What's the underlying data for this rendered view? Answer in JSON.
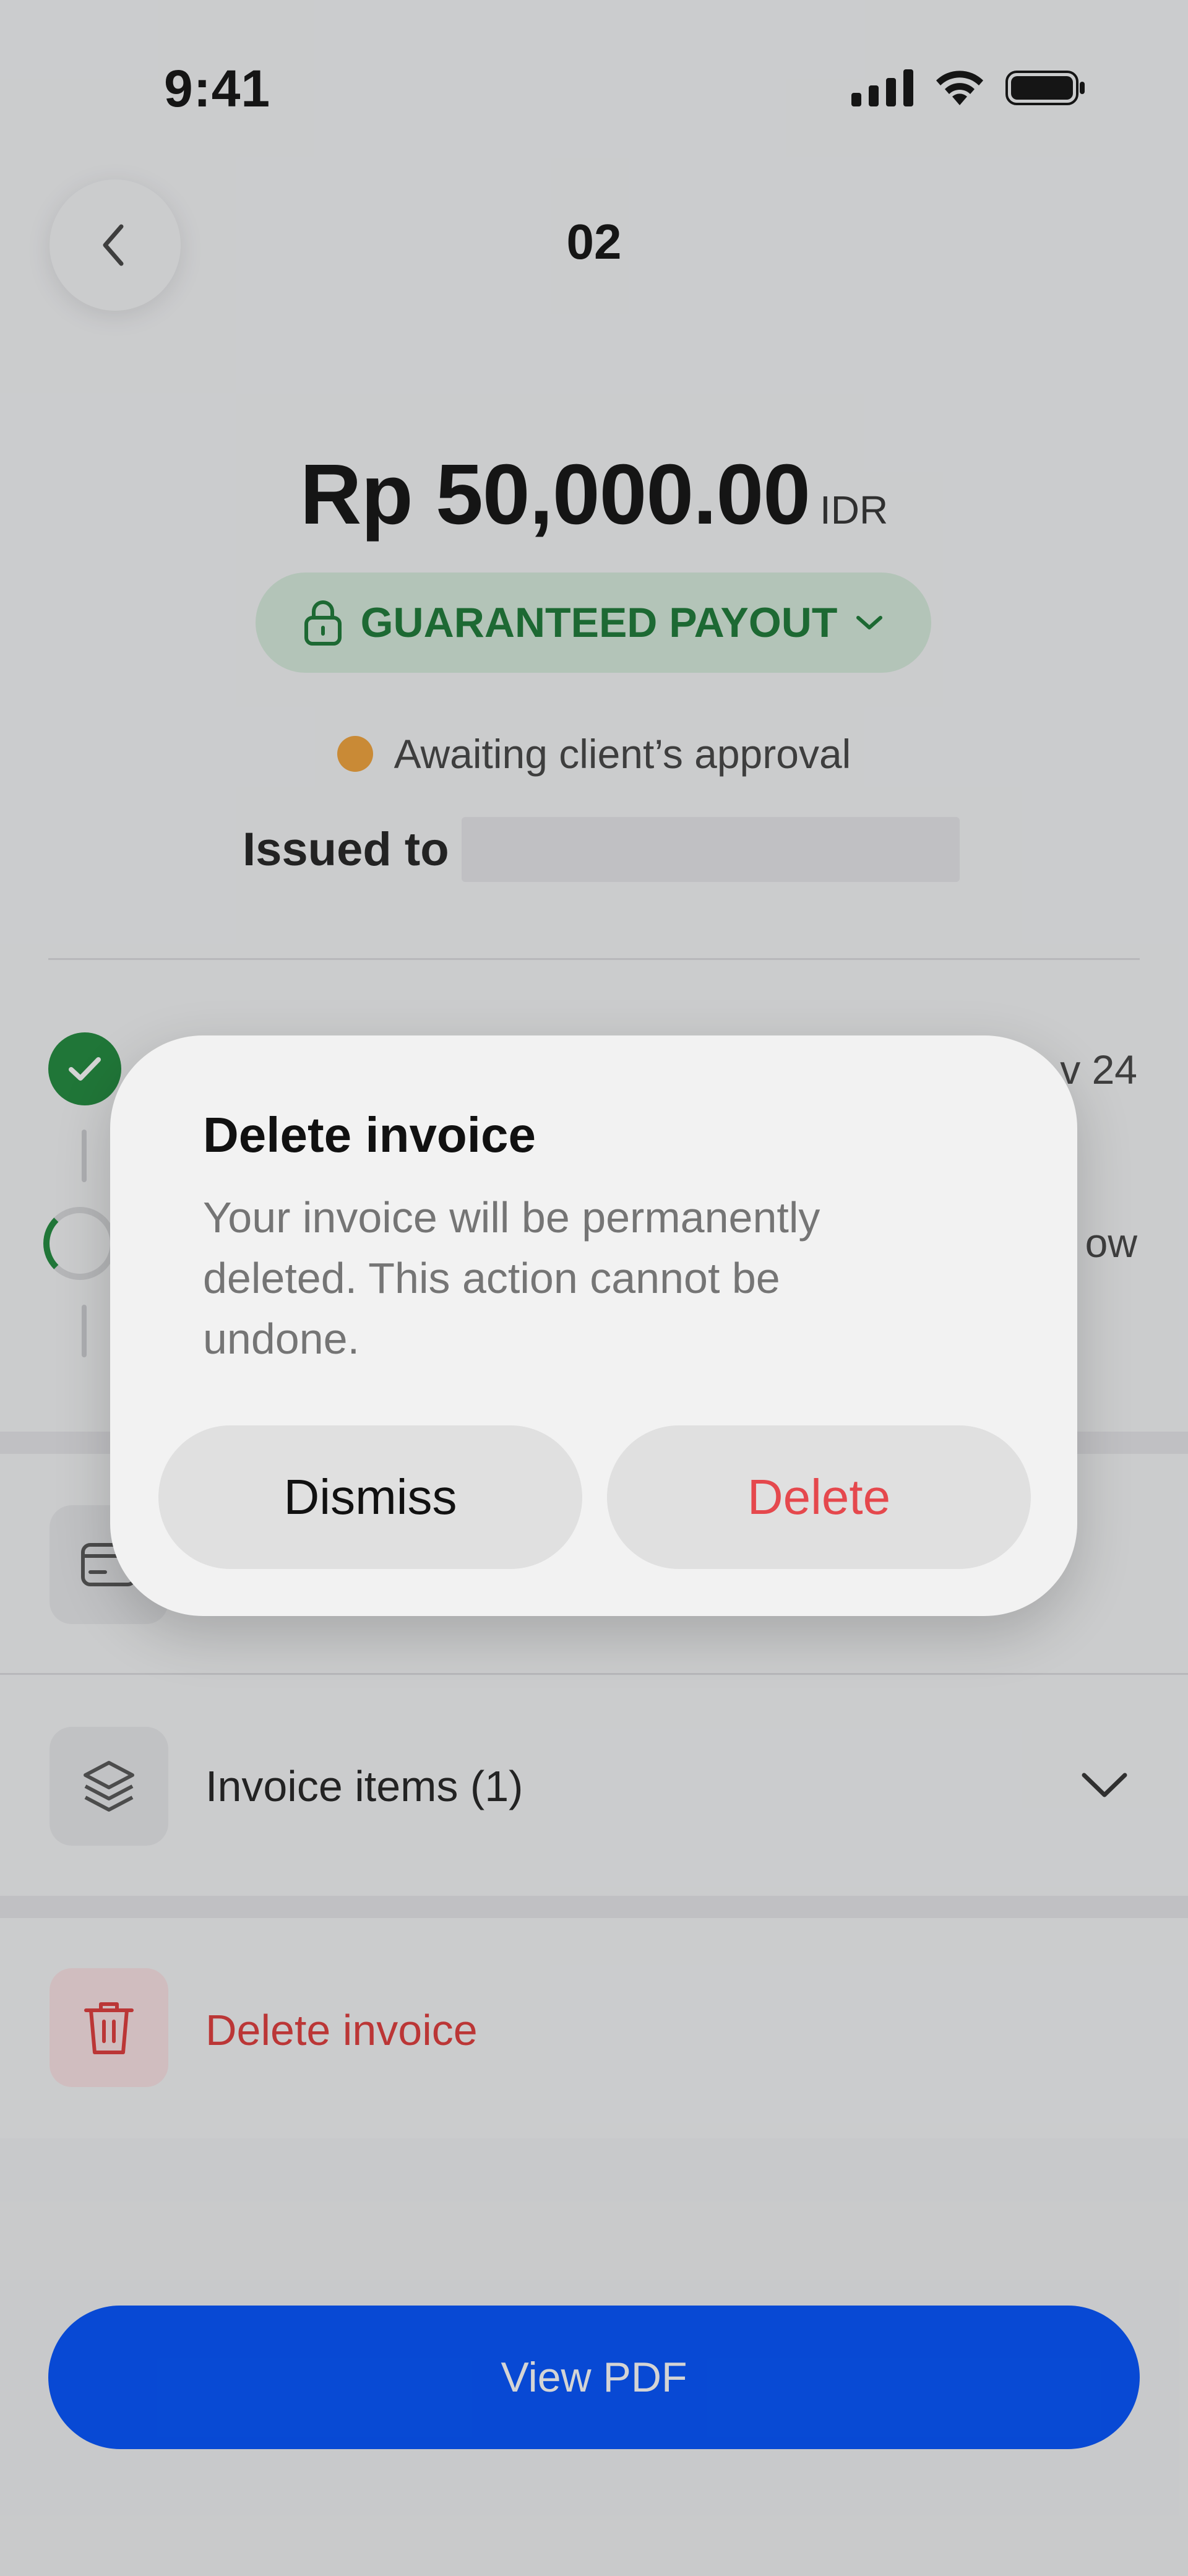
{
  "status_bar": {
    "time": "9:41"
  },
  "header": {
    "title": "02"
  },
  "invoice": {
    "amount": "Rp 50,000.00",
    "currency": "IDR",
    "payout_label": "GUARANTEED PAYOUT",
    "status": "Awaiting client’s approval",
    "issued_to_label": "Issued to"
  },
  "timeline": {
    "date_partial_1": "v 24",
    "date_partial_2": "ow"
  },
  "rows": {
    "items_label": "Invoice items (1)",
    "delete_label": "Delete invoice"
  },
  "footer": {
    "view_pdf_label": "View PDF"
  },
  "dialog": {
    "title": "Delete invoice",
    "message": "Your invoice will be permanently deleted. This action cannot be undone.",
    "dismiss_label": "Dismiss",
    "delete_label": "Delete"
  },
  "colors": {
    "accent": "#0052ff",
    "success": "#1f8a3c",
    "warning": "#f2a33a",
    "danger": "#e5484d"
  }
}
